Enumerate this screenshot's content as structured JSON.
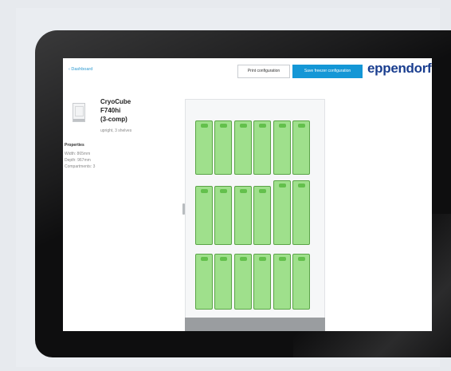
{
  "nav": {
    "back_label": "‹ Dashboard"
  },
  "toolbar": {
    "print_label": "Print configuration",
    "save_label": "Save freezer configuration"
  },
  "brand": {
    "logo_text": "eppendorf",
    "color": "#1a3e8f"
  },
  "product": {
    "name_line1": "CryoCube",
    "name_line2": "F740hi",
    "name_line3": "(3-comp)",
    "subtitle": "upright, 3 shelves"
  },
  "properties": {
    "heading": "Properties",
    "width": "Width: 865mm",
    "depth": "Depth: 967mm",
    "compartments": "Compartments: 3"
  },
  "colors": {
    "accent": "#1497d6",
    "rack_fill": "#9fe08c",
    "rack_border": "#5aa447",
    "rack_tag": "#63c04c"
  },
  "racks": {
    "shelf_1": [
      "A1",
      "A2",
      "A3",
      "A4",
      "A5",
      "A6"
    ],
    "shelf_2": [
      "B1",
      "B2",
      "B3",
      "B4",
      "B5",
      "B6"
    ],
    "shelf_3": [
      "C1",
      "C2",
      "C3",
      "C4",
      "C5",
      "C6"
    ]
  }
}
